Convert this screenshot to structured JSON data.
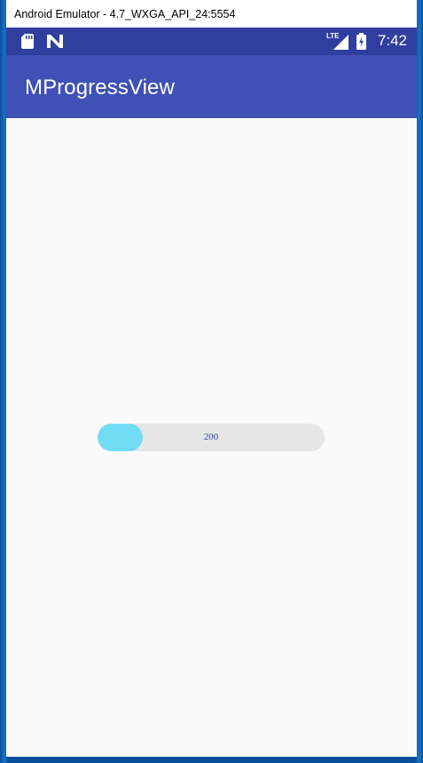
{
  "window": {
    "title": "Android Emulator - 4.7_WXGA_API_24:5554"
  },
  "status_bar": {
    "time": "7:42",
    "network_label": "LTE",
    "icons": [
      "sd-card-icon",
      "android-n-icon",
      "lte-signal-icon",
      "battery-charging-icon"
    ]
  },
  "app_bar": {
    "title": "MProgressView"
  },
  "progress": {
    "label": "200",
    "fraction": 0.2,
    "track_color": "#e6e6e6",
    "fill_color": "#73dcf5",
    "text_color": "#3347a8"
  },
  "colors": {
    "status_bar": "#303f9f",
    "app_bar": "#3f51b5",
    "background": "#fafafa"
  }
}
